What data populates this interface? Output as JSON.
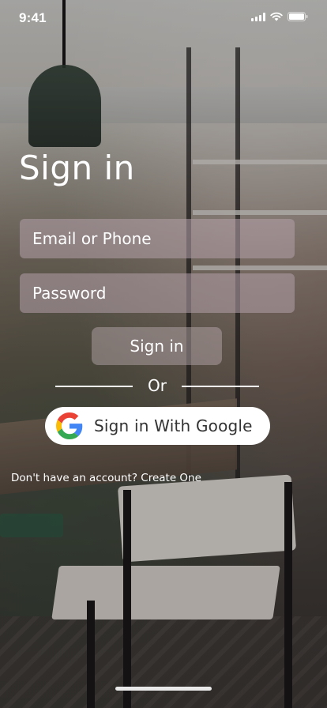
{
  "status_bar": {
    "time": "9:41"
  },
  "header": {
    "title": "Sign in"
  },
  "form": {
    "email_placeholder": "Email or Phone",
    "email_value": "",
    "password_placeholder": "Password",
    "password_value": "",
    "signin_label": "Sign in"
  },
  "divider": {
    "label": "Or"
  },
  "google": {
    "label": "Sign in With Google"
  },
  "footer": {
    "prompt": "Don't have an account?",
    "link": "Create One"
  },
  "icons": {
    "signal": "signal-icon",
    "wifi": "wifi-icon",
    "battery": "battery-icon",
    "google": "google-g-icon"
  }
}
